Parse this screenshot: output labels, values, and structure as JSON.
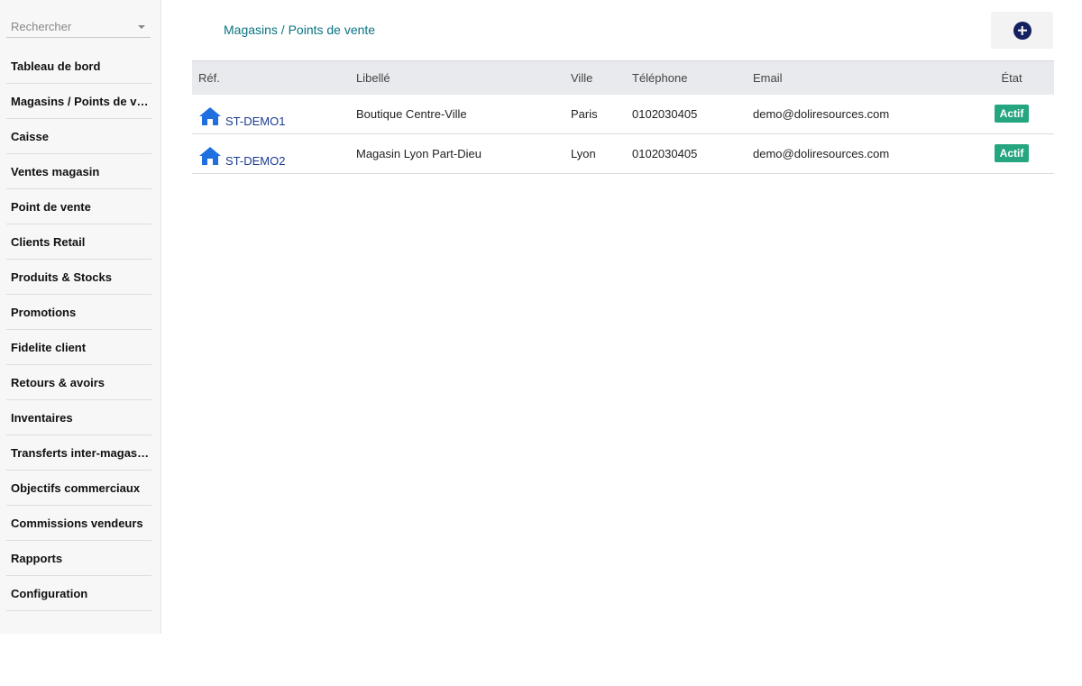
{
  "sidebar": {
    "search": {
      "placeholder": "Rechercher"
    },
    "items": [
      {
        "label": "Tableau de bord"
      },
      {
        "label": "Magasins / Points de vente"
      },
      {
        "label": "Caisse"
      },
      {
        "label": "Ventes magasin"
      },
      {
        "label": "Point de vente"
      },
      {
        "label": "Clients Retail"
      },
      {
        "label": "Produits & Stocks"
      },
      {
        "label": "Promotions"
      },
      {
        "label": "Fidelite client"
      },
      {
        "label": "Retours & avoirs"
      },
      {
        "label": "Inventaires"
      },
      {
        "label": "Transferts inter-magasins"
      },
      {
        "label": "Objectifs commerciaux"
      },
      {
        "label": "Commissions vendeurs"
      },
      {
        "label": "Rapports"
      },
      {
        "label": "Configuration"
      }
    ]
  },
  "header": {
    "title": "Magasins / Points de vente",
    "add_icon": "plus-circle-icon"
  },
  "table": {
    "columns": {
      "ref": "Réf.",
      "label": "Libellé",
      "city": "Ville",
      "phone": "Téléphone",
      "email": "Email",
      "status": "État"
    },
    "rows": [
      {
        "icon": "home-icon",
        "ref": "ST-DEMO1",
        "label": "Boutique Centre-Ville",
        "city": "Paris",
        "phone": "0102030405",
        "email": "demo@doliresources.com",
        "status": "Actif"
      },
      {
        "icon": "home-icon",
        "ref": "ST-DEMO2",
        "label": "Magasin Lyon Part-Dieu",
        "city": "Lyon",
        "phone": "0102030405",
        "email": "demo@doliresources.com",
        "status": "Actif"
      }
    ]
  },
  "colors": {
    "title": "#0a7380",
    "badge": "#25a580",
    "icon_blue": "#1f6fe0",
    "add_button": "#14205f"
  }
}
